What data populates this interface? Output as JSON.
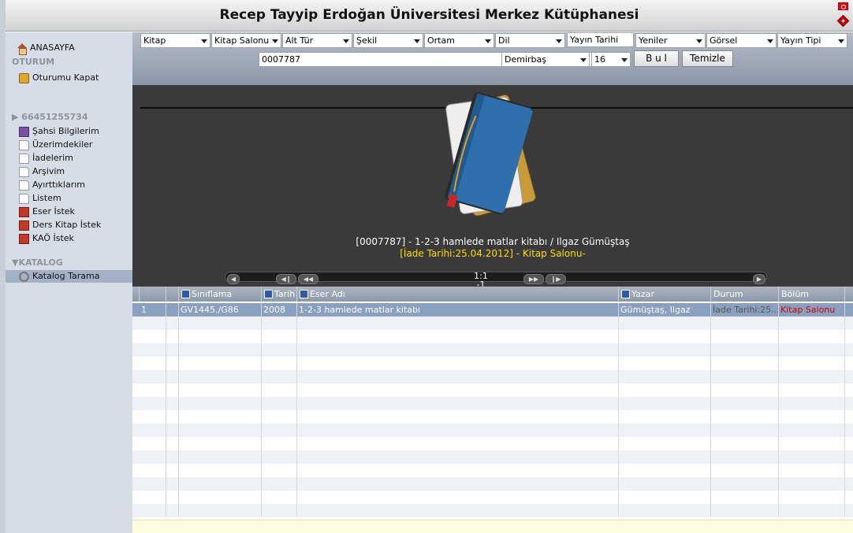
{
  "app": {
    "title": "Recep Tayyip Erdoğan Üniversitesi Merkez Kütüphanesi"
  },
  "sidebar": {
    "home": "ANASAYFA",
    "session_header": "OTURUM",
    "logout": "Oturumu Kapat",
    "user_id": "▶ 66451255734",
    "items": [
      {
        "label": "Şahsi Bilgilerim",
        "icon": "user-icon"
      },
      {
        "label": "Üzerimdekiler",
        "icon": "document-icon"
      },
      {
        "label": "İadelerim",
        "icon": "document-icon"
      },
      {
        "label": "Arşivim",
        "icon": "document-icon"
      },
      {
        "label": "Ayırttıklarım",
        "icon": "document-icon"
      },
      {
        "label": "Listem",
        "icon": "document-icon"
      },
      {
        "label": "Eser İstek",
        "icon": "book-icon"
      },
      {
        "label": "Ders Kitap İstek",
        "icon": "book-icon"
      },
      {
        "label": "KAÖ İstek",
        "icon": "book-icon"
      }
    ],
    "catalog_header": "▼KATALOG",
    "catalog_search": "Katalog Tarama"
  },
  "filters": {
    "row1": [
      "Kitap",
      "Kitap Salonu",
      "Alt Tür",
      "Şekil",
      "Ortam",
      "Dil"
    ],
    "publish_date": "Yayın Tarihi",
    "row1b": [
      "Yeniler",
      "Görsel",
      "Yayın Tipi"
    ],
    "search_value": "0007787",
    "field": "Demirbaş",
    "page_size": "16",
    "find_button": "B u l",
    "clear_button": "Temizle"
  },
  "viewer": {
    "caption": "[0007787] - 1-2-3 hamlede matlar kitabı / Ilgaz Gümüştaş",
    "subcaption": "[İade Tarihi:25.04.2012] - Kitap Salonu-",
    "page_text": "1:1",
    "page_sub": "-1"
  },
  "table": {
    "columns": [
      "Sınıflama",
      "Tarih",
      "Eser Adı",
      "Yazar",
      "Durum",
      "Bölüm"
    ],
    "rows": [
      {
        "no": "1",
        "siniflama": "GV1445./G86",
        "tarih": "2008",
        "eser": "1-2-3 hamlede matlar kitabı",
        "yazar": "Gümüştaş, Ilgaz",
        "durum": "İade Tarihi:25...",
        "bolum": "Kitap Salonu"
      }
    ],
    "status_colors": {
      "durum": "#666666",
      "bolum": "#cc0000"
    }
  }
}
